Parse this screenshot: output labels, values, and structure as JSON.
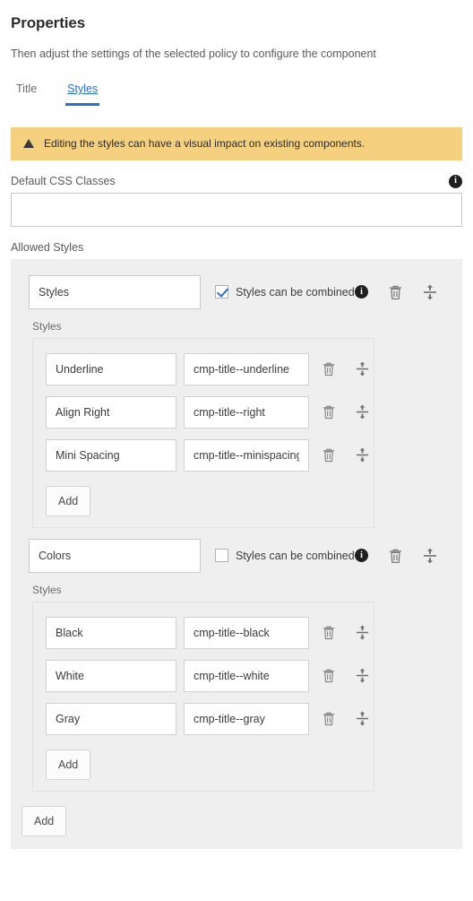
{
  "header": {
    "title": "Properties",
    "description": "Then adjust the settings of the selected policy to configure the component"
  },
  "tabs": [
    {
      "label": "Title",
      "active": false
    },
    {
      "label": "Styles",
      "active": true
    }
  ],
  "warning": {
    "icon": "warning-triangle-icon",
    "text": "Editing the styles can have a visual impact on existing components.",
    "background": "#f5d07e"
  },
  "default_css_classes": {
    "label": "Default CSS Classes",
    "value": "",
    "placeholder": "",
    "info_icon": "info-icon"
  },
  "allowed_styles": {
    "label": "Allowed Styles",
    "sub_label": "Styles",
    "combine_label": "Styles can be combined",
    "add_label": "Add",
    "icons": {
      "info": "info-icon",
      "delete": "trash-icon",
      "reorder": "drag-handle-icon"
    },
    "groups": [
      {
        "name": "Styles",
        "can_be_combined": true,
        "styles": [
          {
            "name": "Underline",
            "css_class": "cmp-title--underline"
          },
          {
            "name": "Align Right",
            "css_class": "cmp-title--right"
          },
          {
            "name": "Mini Spacing",
            "css_class": "cmp-title--minispacing"
          }
        ]
      },
      {
        "name": "Colors",
        "can_be_combined": false,
        "styles": [
          {
            "name": "Black",
            "css_class": "cmp-title--black"
          },
          {
            "name": "White",
            "css_class": "cmp-title--white"
          },
          {
            "name": "Gray",
            "css_class": "cmp-title--gray"
          }
        ]
      }
    ],
    "group_add_label": "Add"
  },
  "colors": {
    "accent": "#2a6ed4",
    "warning_bg": "#f5d07e",
    "panel_bg": "#efefef",
    "text": "#4b4b4b"
  }
}
